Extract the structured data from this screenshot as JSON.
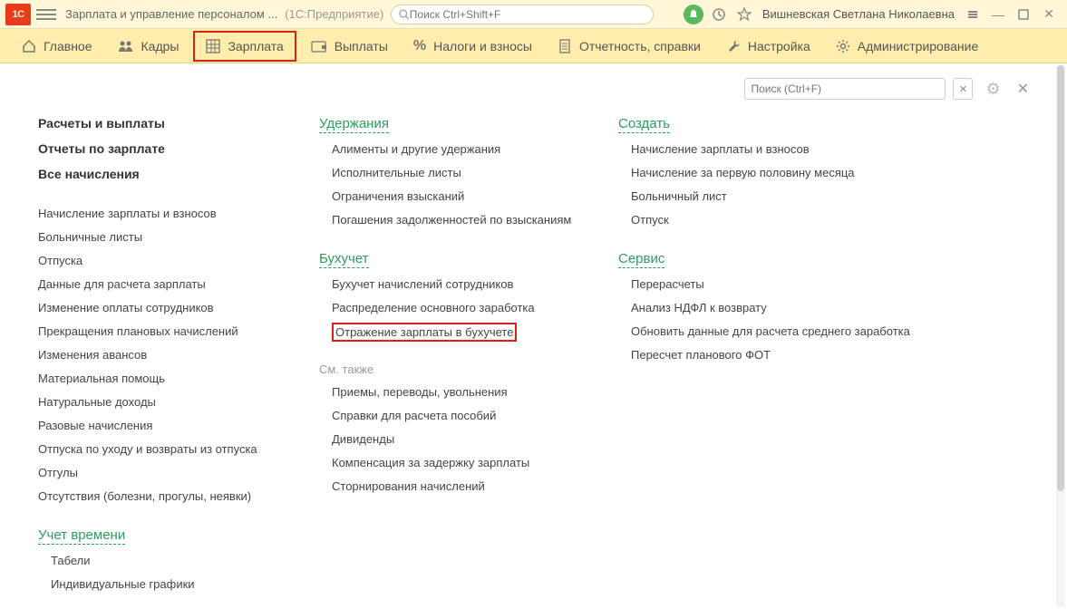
{
  "titlebar": {
    "logo_text": "1C",
    "app_title": "Зарплата и управление персоналом ...",
    "platform": "(1С:Предприятие)",
    "search_placeholder": "Поиск Ctrl+Shift+F",
    "user_name": "Вишневская Светлана Николаевна"
  },
  "menu": [
    {
      "icon": "home",
      "label": "Главное"
    },
    {
      "icon": "people",
      "label": "Кадры"
    },
    {
      "icon": "grid",
      "label": "Зарплата",
      "active": true
    },
    {
      "icon": "wallet",
      "label": "Выплаты"
    },
    {
      "icon": "percent",
      "label": "Налоги и взносы"
    },
    {
      "icon": "doc",
      "label": "Отчетность, справки"
    },
    {
      "icon": "wrench",
      "label": "Настройка"
    },
    {
      "icon": "gear",
      "label": "Администрирование"
    }
  ],
  "local_search_placeholder": "Поиск (Ctrl+F)",
  "col1": {
    "bold": [
      "Расчеты и выплаты",
      "Отчеты по зарплате",
      "Все начисления"
    ],
    "links": [
      "Начисление зарплаты и взносов",
      "Больничные листы",
      "Отпуска",
      "Данные для расчета зарплаты",
      "Изменение оплаты сотрудников",
      "Прекращения плановых начислений",
      "Изменения авансов",
      "Материальная помощь",
      "Натуральные доходы",
      "Разовые начисления",
      "Отпуска по уходу и возвраты из отпуска",
      "Отгулы",
      "Отсутствия (болезни, прогулы, неявки)"
    ],
    "section2": "Учет времени",
    "links2": [
      "Табели",
      "Индивидуальные графики"
    ]
  },
  "col2": {
    "section1": "Удержания",
    "links1": [
      "Алименты и другие удержания",
      "Исполнительные листы",
      "Ограничения взысканий",
      "Погашения задолженностей по взысканиям"
    ],
    "section2": "Бухучет",
    "links2": [
      "Бухучет начислений сотрудников",
      "Распределение основного заработка"
    ],
    "highlighted": "Отражение зарплаты в бухучете",
    "subhead": "См. также",
    "links3": [
      "Приемы, переводы, увольнения",
      "Справки для расчета пособий",
      "Дивиденды",
      "Компенсация за задержку зарплаты",
      "Сторнирования начислений"
    ]
  },
  "col3": {
    "section1": "Создать",
    "links1": [
      "Начисление зарплаты и взносов",
      "Начисление за первую половину месяца",
      "Больничный лист",
      "Отпуск"
    ],
    "section2": "Сервис",
    "links2": [
      "Перерасчеты",
      "Анализ НДФЛ к возврату",
      "Обновить данные для расчета среднего заработка",
      "Пересчет планового ФОТ"
    ]
  }
}
